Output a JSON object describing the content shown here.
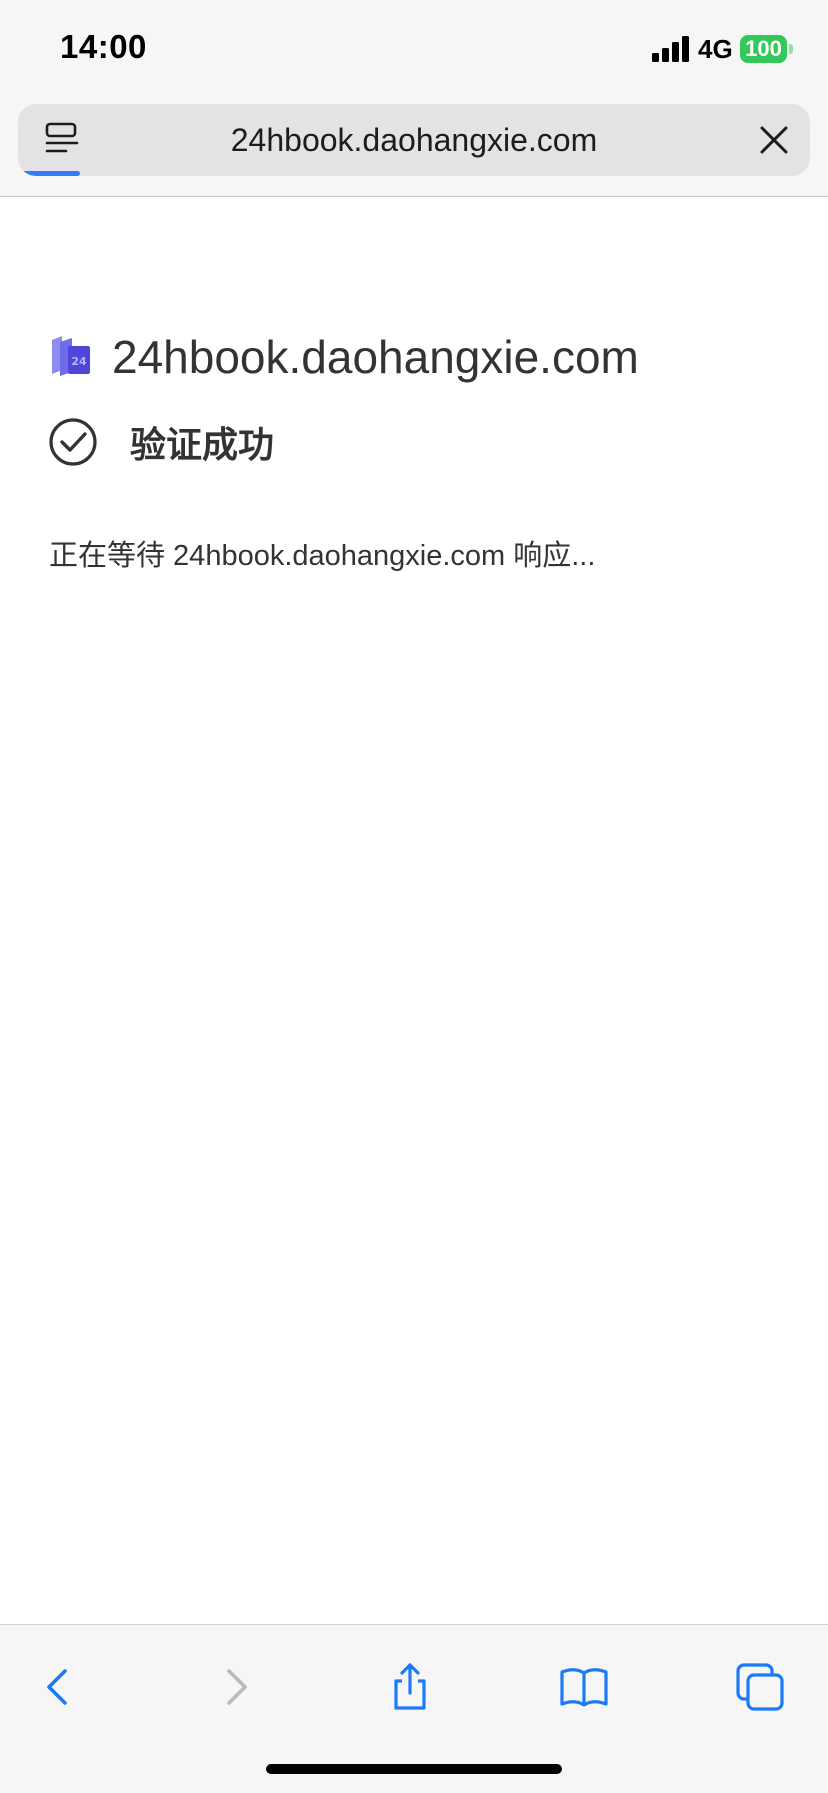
{
  "status_bar": {
    "time": "14:00",
    "network": "4G",
    "battery": "100",
    "icons": [
      "signal-bars-icon",
      "battery-icon"
    ],
    "battery_color": "#34c759"
  },
  "browser": {
    "url": "24hbook.daohangxie.com",
    "icons": [
      "reader-mode-icon",
      "close-icon"
    ],
    "progress_color": "#2f7cf6"
  },
  "content": {
    "site_title": "24hbook.daohangxie.com",
    "verify_status": "验证成功",
    "waiting_message": "正在等待 24hbook.daohangxie.com 响应..."
  },
  "toolbar": {
    "icons": [
      "back-icon",
      "forward-icon",
      "share-icon",
      "bookmarks-icon",
      "tabs-icon"
    ],
    "accent_color": "#1a7cf5",
    "disabled_color": "#b9b9be"
  }
}
